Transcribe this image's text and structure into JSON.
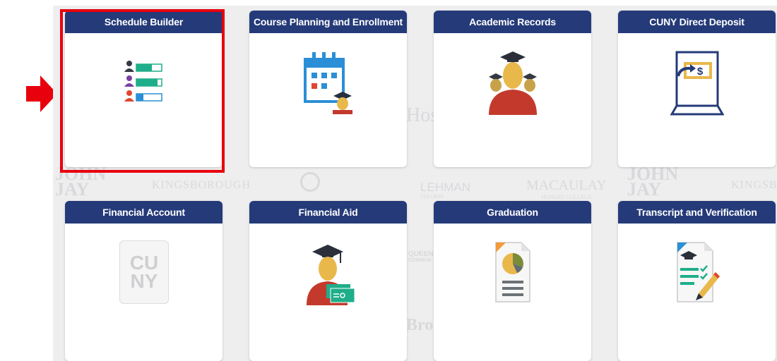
{
  "tiles": [
    {
      "id": "schedule-builder",
      "label": "Schedule Builder",
      "highlighted": true
    },
    {
      "id": "course-planning",
      "label": "Course Planning and Enrollment"
    },
    {
      "id": "academic-records",
      "label": "Academic Records"
    },
    {
      "id": "cuny-direct-deposit",
      "label": "CUNY Direct Deposit"
    },
    {
      "id": "financial-account",
      "label": "Financial Account"
    },
    {
      "id": "financial-aid",
      "label": "Financial Aid"
    },
    {
      "id": "graduation",
      "label": "Graduation"
    },
    {
      "id": "transcript-verification",
      "label": "Transcript and Verification"
    }
  ],
  "watermarks": {
    "kingsborough": "KINGSBOROUGH",
    "lehman": "LEHMAN",
    "lehman_sub": "COLLEGE",
    "macaulay": "MACAULAY",
    "macaulay_sub": "HONORS COLLEGE",
    "john": "JOHN",
    "jay": "JAY",
    "hos": "Hos",
    "brookl": "Brookl",
    "queens": "QUEEN",
    "queens_sub": "COMMUN"
  },
  "icons": {
    "schedule_builder": "schedule-people-bars-icon",
    "course_planning": "calendar-graduate-icon",
    "academic_records": "graduates-group-icon",
    "direct_deposit": "laptop-dollar-icon",
    "financial_account": "cuny-logo-icon",
    "financial_aid": "graduate-money-icon",
    "graduation": "report-pie-chart-icon",
    "transcript": "transcript-checklist-icon"
  },
  "cuny_logo": {
    "line1": "CU",
    "line2": "NY"
  },
  "colors": {
    "tile_header": "#243a79",
    "highlight": "#e8000d",
    "arrow": "#e8000d",
    "green": "#1fae8a",
    "blue": "#2a8fd6",
    "gold": "#e9b84a",
    "red": "#c33a2c"
  }
}
